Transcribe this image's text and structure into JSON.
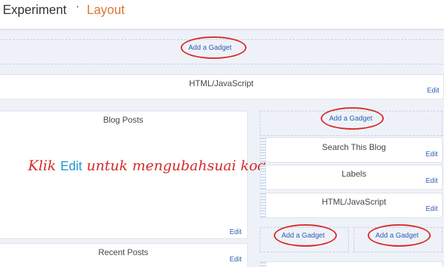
{
  "header": {
    "title": "Experiment",
    "separator": "·",
    "section": "Layout"
  },
  "gadget_label": "Add a Gadget",
  "edit_label": "Edit",
  "header_widget": {
    "label": "HTML/JavaScript"
  },
  "main": {
    "blog_posts": {
      "label": "Blog Posts"
    },
    "recent_posts": {
      "label": "Recent Posts"
    }
  },
  "sidebar": {
    "widgets": [
      {
        "label": "Search This Blog"
      },
      {
        "label": "Labels"
      },
      {
        "label": "HTML/JavaScript"
      }
    ]
  },
  "annotation": {
    "before": "Klik ",
    "highlight": "Edit",
    "after": " untuk mengubahsuai kod"
  },
  "colors": {
    "accent": "#dd7532",
    "link": "#2a5db0",
    "highlight_ring": "#d92b2b"
  }
}
